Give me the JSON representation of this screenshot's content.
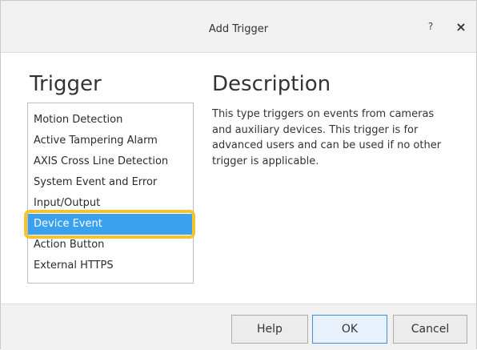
{
  "dialog": {
    "title": "Add Trigger",
    "help_glyph": "?",
    "close_glyph": "×",
    "close_icon": "close-icon",
    "help_icon": "question-icon"
  },
  "trigger": {
    "heading": "Trigger",
    "items": [
      {
        "label": "Motion Detection",
        "selected": false
      },
      {
        "label": "Active Tampering Alarm",
        "selected": false
      },
      {
        "label": "AXIS Cross Line Detection",
        "selected": false
      },
      {
        "label": "System Event and Error",
        "selected": false
      },
      {
        "label": "Input/Output",
        "selected": false
      },
      {
        "label": "Device Event",
        "selected": true
      },
      {
        "label": "Action Button",
        "selected": false
      },
      {
        "label": "External HTTPS",
        "selected": false
      }
    ]
  },
  "description": {
    "heading": "Description",
    "text": "This type triggers on events from cameras and auxiliary devices. This trigger is for advanced users and can be used if no other trigger is applicable."
  },
  "footer": {
    "help_label": "Help",
    "ok_label": "OK",
    "cancel_label": "Cancel"
  },
  "colors": {
    "selection": "#3aa0f0",
    "highlight": "#f5c330",
    "titlebar": "#f1f1f1"
  }
}
